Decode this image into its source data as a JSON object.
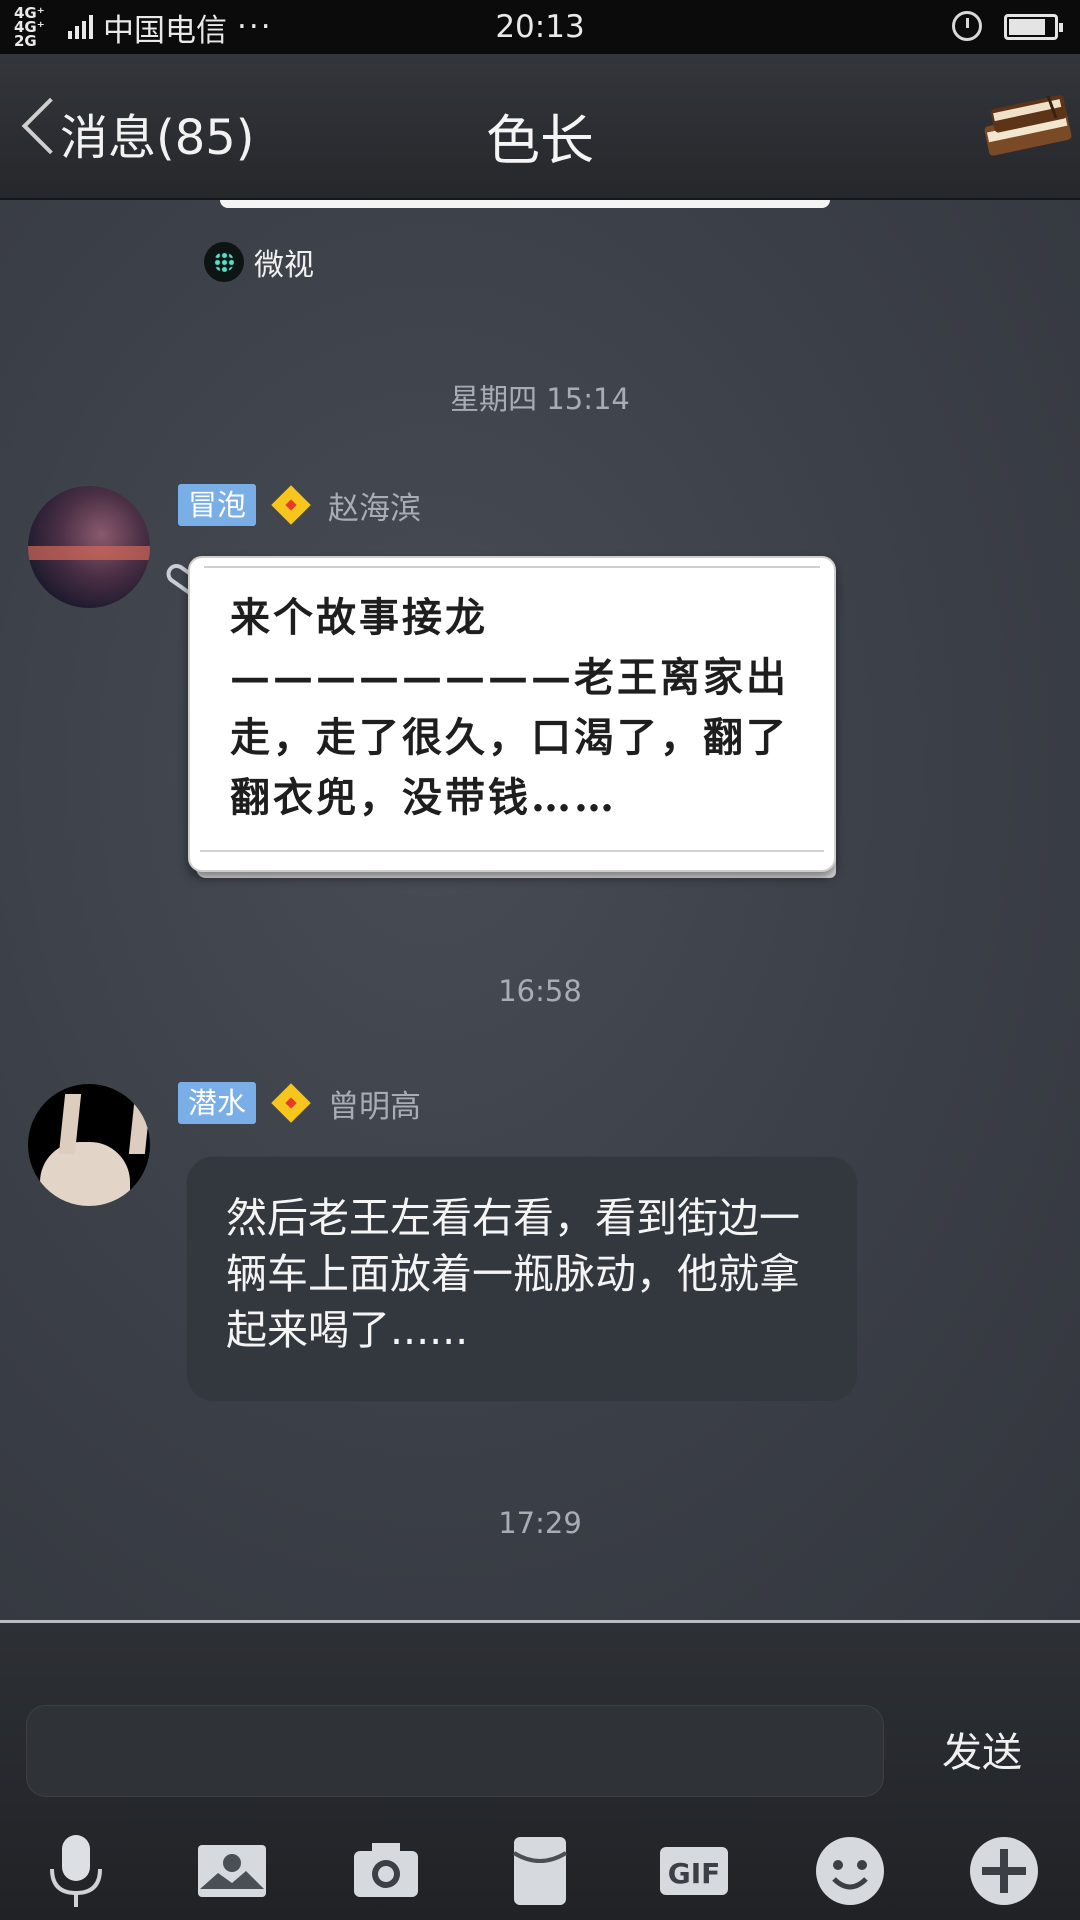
{
  "status_bar": {
    "network": "4G⁺ 4G⁺ 2G",
    "carrier": "中国电信",
    "more": "···",
    "time": "20:13",
    "icons": [
      "signal-icon",
      "alarm-icon",
      "battery-icon"
    ]
  },
  "header": {
    "back_label": "消息(85)",
    "title": "色长",
    "right_icon": "book-icon"
  },
  "chat": {
    "shared_app": "微视",
    "timestamps": [
      "星期四 15:14",
      "16:58",
      "17:29"
    ],
    "messages": [
      {
        "level": "冒泡",
        "sender": "赵海滨",
        "text": "来个故事接龙————————老王离家出走，走了很久，口渴了，翻了翻衣兜，没带钱……",
        "style": "paper"
      },
      {
        "level": "潜水",
        "sender": "曾明高",
        "text": "然后老王左看右看，看到街边一辆车上面放着一瓶脉动，他就拿起来喝了......",
        "style": "dark"
      }
    ]
  },
  "input": {
    "value": "",
    "send_label": "发送"
  },
  "toolbar": [
    "microphone-icon",
    "photo-icon",
    "camera-icon",
    "red-packet-icon",
    "gif-icon",
    "emoji-icon",
    "plus-icon"
  ],
  "colors": {
    "level_badge": "#7aaee6",
    "diamond": "#f6c61c",
    "chat_bg": "#3f434b"
  }
}
